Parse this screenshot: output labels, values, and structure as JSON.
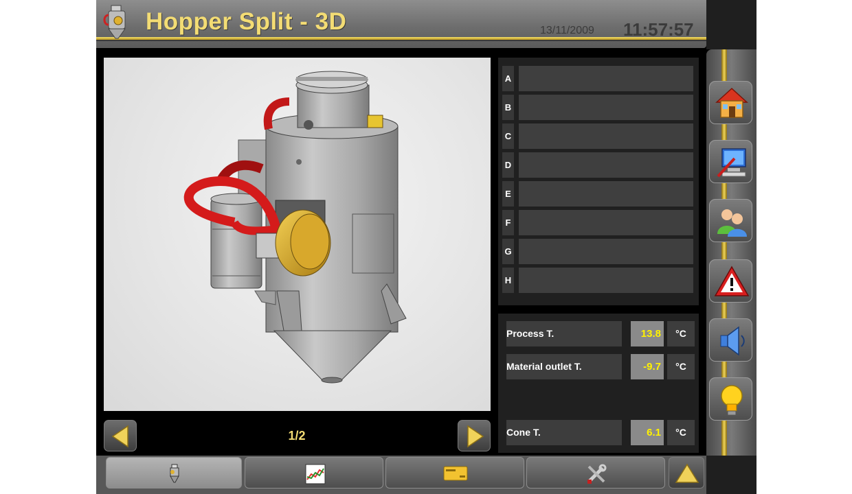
{
  "header": {
    "title": "Hopper Split - 3D",
    "date": "13/11/2009",
    "time": "11:57:57",
    "app_icon": "hopper-icon"
  },
  "viewer": {
    "page_indicator": "1/2",
    "prev_icon": "arrow-left-icon",
    "next_icon": "arrow-right-icon"
  },
  "letters": [
    "A",
    "B",
    "C",
    "D",
    "E",
    "F",
    "G",
    "H"
  ],
  "temperatures": [
    {
      "label": "Process T.",
      "value": "13.8",
      "unit": "°C"
    },
    {
      "label": "Material outlet T.",
      "value": "-9.7",
      "unit": "°C"
    },
    {
      "label": "Cone T.",
      "value": "6.1",
      "unit": "°C"
    }
  ],
  "sidebar": {
    "buttons": [
      "home-icon",
      "computer-icon",
      "users-icon",
      "warning-icon",
      "speaker-icon",
      "lightbulb-icon"
    ]
  },
  "toolbar": {
    "tabs": [
      "hopper-icon",
      "chart-icon",
      "card-icon",
      "tools-icon"
    ],
    "up_icon": "arrow-up-icon"
  },
  "colors": {
    "title": "#f3dc74",
    "accent_gold": "#e8c83a",
    "value_yellow": "#fff200",
    "panel_bg": "#202020"
  }
}
